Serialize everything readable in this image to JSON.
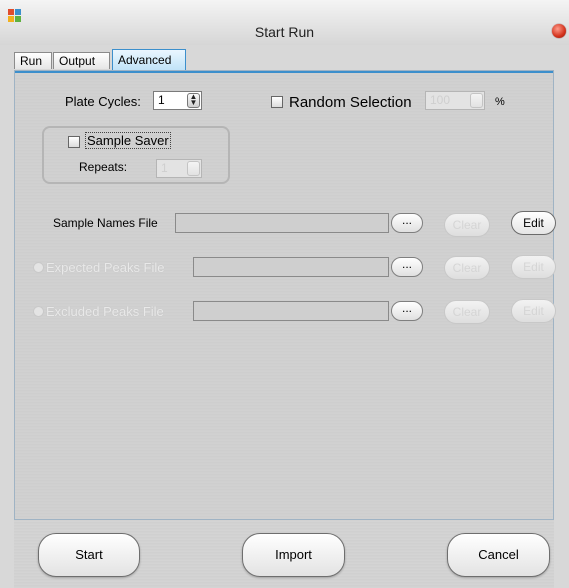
{
  "window": {
    "title": "Start Run"
  },
  "tabs": [
    {
      "label": "Run"
    },
    {
      "label": "Output"
    },
    {
      "label": "Advanced",
      "active": true
    }
  ],
  "advanced": {
    "plate_cycles": {
      "label": "Plate Cycles:",
      "value": "1"
    },
    "random_selection": {
      "label": "Random Selection",
      "value": "100",
      "unit": "%",
      "checked": false
    },
    "sample_saver": {
      "label": "Sample Saver",
      "checked": false,
      "repeats_label": "Repeats:",
      "repeats_value": "1"
    },
    "sample_names_file": {
      "label": "Sample Names File",
      "browse": "...",
      "clear": "Clear",
      "edit": "Edit"
    },
    "expected_peaks_file": {
      "label": "Expected Peaks File",
      "browse": "...",
      "clear": "Clear",
      "edit": "Edit"
    },
    "excluded_peaks_file": {
      "label": "Excluded Peaks File",
      "browse": "...",
      "clear": "Clear",
      "edit": "Edit"
    }
  },
  "footer": {
    "start": "Start",
    "import": "Import",
    "cancel": "Cancel"
  },
  "colors": {
    "accent": "#3c8fcc",
    "close": "#d3321c"
  }
}
